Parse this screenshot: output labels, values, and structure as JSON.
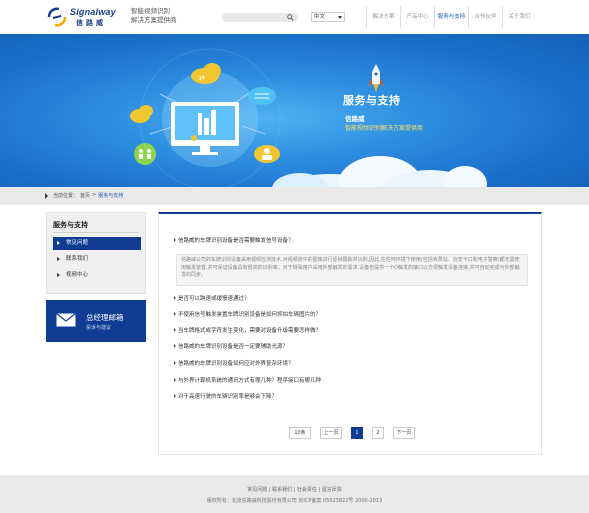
{
  "header": {
    "logo_en": "Signalway",
    "logo_cn": "信路威",
    "slogan_line1": "智能视频识别",
    "slogan_line2": "解决方案提供商",
    "search_placeholder": "",
    "language": "中文",
    "nav": [
      {
        "label": "解决方案",
        "active": false
      },
      {
        "label": "产品中心",
        "active": false
      },
      {
        "label": "服务与支持",
        "active": true
      },
      {
        "label": "合作伙伴",
        "active": false
      },
      {
        "label": "关于我们",
        "active": false
      }
    ]
  },
  "banner": {
    "title": "服务与支持",
    "subtitle_brand": "信路威",
    "subtitle_text": "智能视频识别解决方案提供商"
  },
  "breadcrumb": {
    "prefix": "当前位置：",
    "home": "首页",
    "sep": ">",
    "current": "服务与支持"
  },
  "sidebar": {
    "title": "服务与支持",
    "items": [
      {
        "label": "常见问题",
        "active": true
      },
      {
        "label": "联系我们",
        "active": false
      },
      {
        "label": "视频中心",
        "active": false
      }
    ],
    "mailbox": {
      "title": "总经理邮箱",
      "subtitle": "投诉与建议"
    }
  },
  "faq": {
    "items": [
      "信路威的车牌识别设备是否需要触发信号设备？",
      "是否可以跨速或缓慢速通过？",
      "不使用信号触发装置车牌识别设备是如何抓拍车辆图片的？",
      "当车牌格式或字符发生变化，需要对设备升级需要怎样做？",
      "信路威的车牌识别设备是否一定要辅助光源？",
      "信路威的车牌识别设备如何应对外界复杂环境？",
      "与外界计算机系统的通讯方式有哪几种？程序接口有哪几种",
      "对于高速行驶的车辆识别率是够会下降？"
    ],
    "answer": "信路威公司的车牌识别设备采用视频检测技术,对视频流中的图像进行逐帧跟踪并识别,因此,在任何环境下使用(包括收费站、治安卡口和电子警察)都无需使用触发装置,并可保证设备具有很高的识别率。对于特殊用户采用外部触发的需求,设备也提供一个D触发的接口以方便触发设备连接,并可自动完成与外部触发的同步。"
  },
  "pager": {
    "total": "10条",
    "prev": "上一页",
    "pages": [
      "1",
      "2"
    ],
    "current": "1",
    "next": "下一页"
  },
  "footer": {
    "links": "常见问题 | 联系我们 | 社会责任 | 留言反馈",
    "copyright": "版权所有：北京信路威科技股份有限公司  京ICP备案 05023822号  2000-2013"
  }
}
